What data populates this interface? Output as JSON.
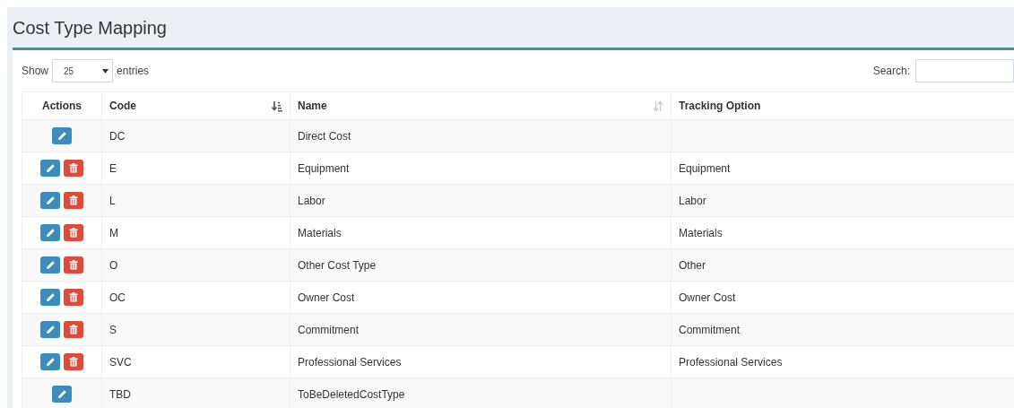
{
  "page": {
    "title": "Cost Type Mapping"
  },
  "length_menu": {
    "before": "Show",
    "value": "25",
    "after": "entries"
  },
  "search": {
    "label": "Search:"
  },
  "table": {
    "columns": [
      {
        "label": "Actions",
        "sortable": false
      },
      {
        "label": "Code",
        "sortable": true,
        "sorted": true
      },
      {
        "label": "Name",
        "sortable": true,
        "sorted": false
      },
      {
        "label": "Tracking Option",
        "sortable": false
      }
    ],
    "rows": [
      {
        "code": "DC",
        "name": "Direct Cost",
        "deletable": false
      },
      {
        "code": "E",
        "name": "Equipment",
        "tracking": "Equipment",
        "deletable": true
      },
      {
        "code": "L",
        "name": "Labor",
        "tracking": "Labor",
        "deletable": true
      },
      {
        "code": "M",
        "name": "Materials",
        "tracking": "Materials",
        "deletable": true
      },
      {
        "code": "O",
        "name": "Other Cost Type",
        "tracking": "Other",
        "deletable": true
      },
      {
        "code": "OC",
        "name": "Owner Cost",
        "tracking": "Owner Cost",
        "deletable": true
      },
      {
        "code": "S",
        "name": "Commitment",
        "tracking": "Commitment",
        "deletable": true
      },
      {
        "code": "SVC",
        "name": "Professional Services",
        "tracking": "Professional Services",
        "deletable": true
      },
      {
        "code": "TBD",
        "name": "ToBeDeletedCostType",
        "deletable": false
      }
    ]
  }
}
